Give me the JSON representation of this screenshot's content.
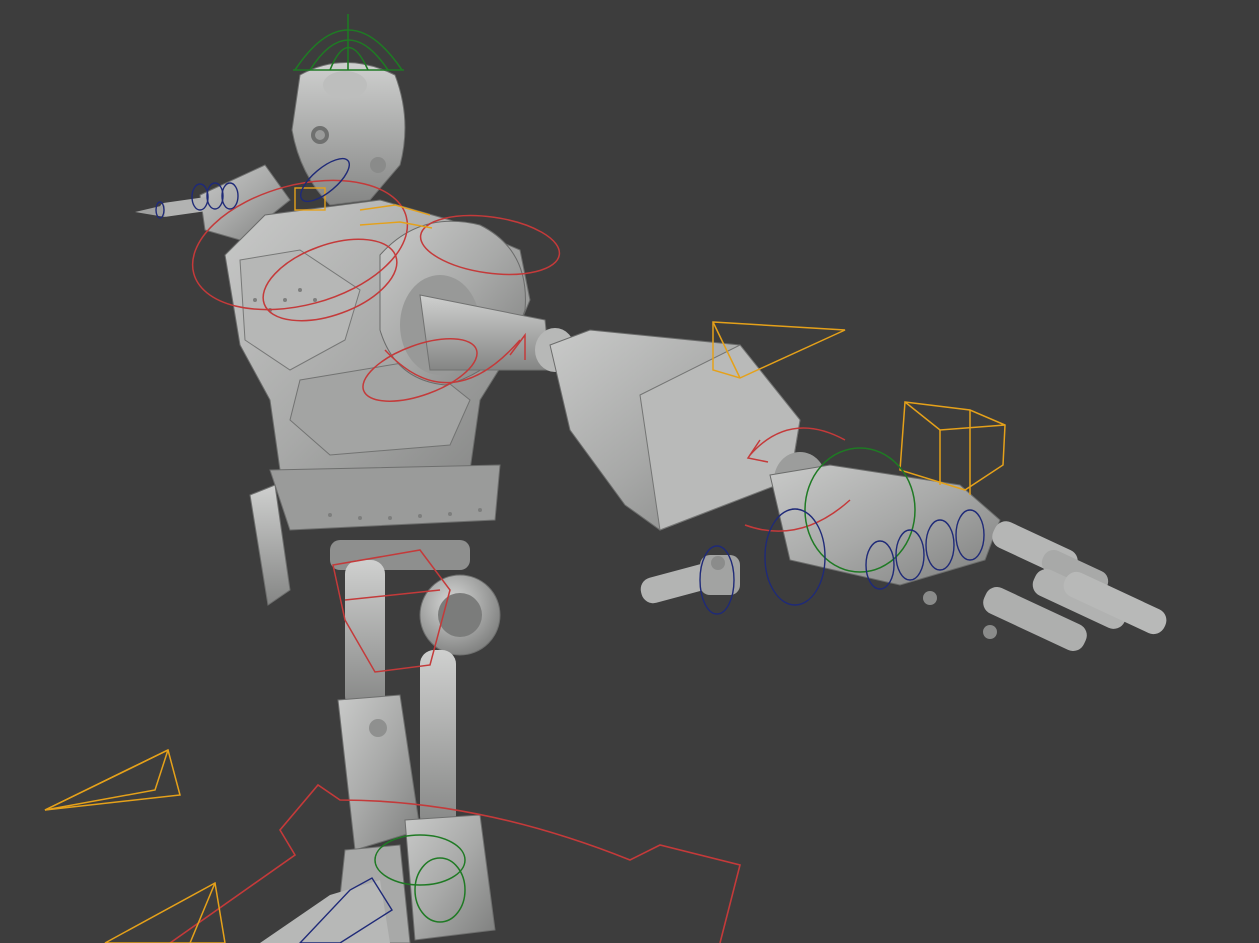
{
  "viewport": {
    "background": "#3d3d3d"
  },
  "model": {
    "mesh_color": "#a9aaa9",
    "mesh_shadow": "#7f807f",
    "mesh_highlight": "#cfd0cf"
  },
  "rig_controls": {
    "ik_fk_color": "#c43a3a",
    "fk_color": "#1f2a78",
    "head_color": "#1f7a24",
    "helper_color": "#e5a11a"
  },
  "icons": {
    "root": "root-control-icon",
    "head": "head-control-icon",
    "pole": "pole-target-icon",
    "finger": "finger-control-icon"
  }
}
